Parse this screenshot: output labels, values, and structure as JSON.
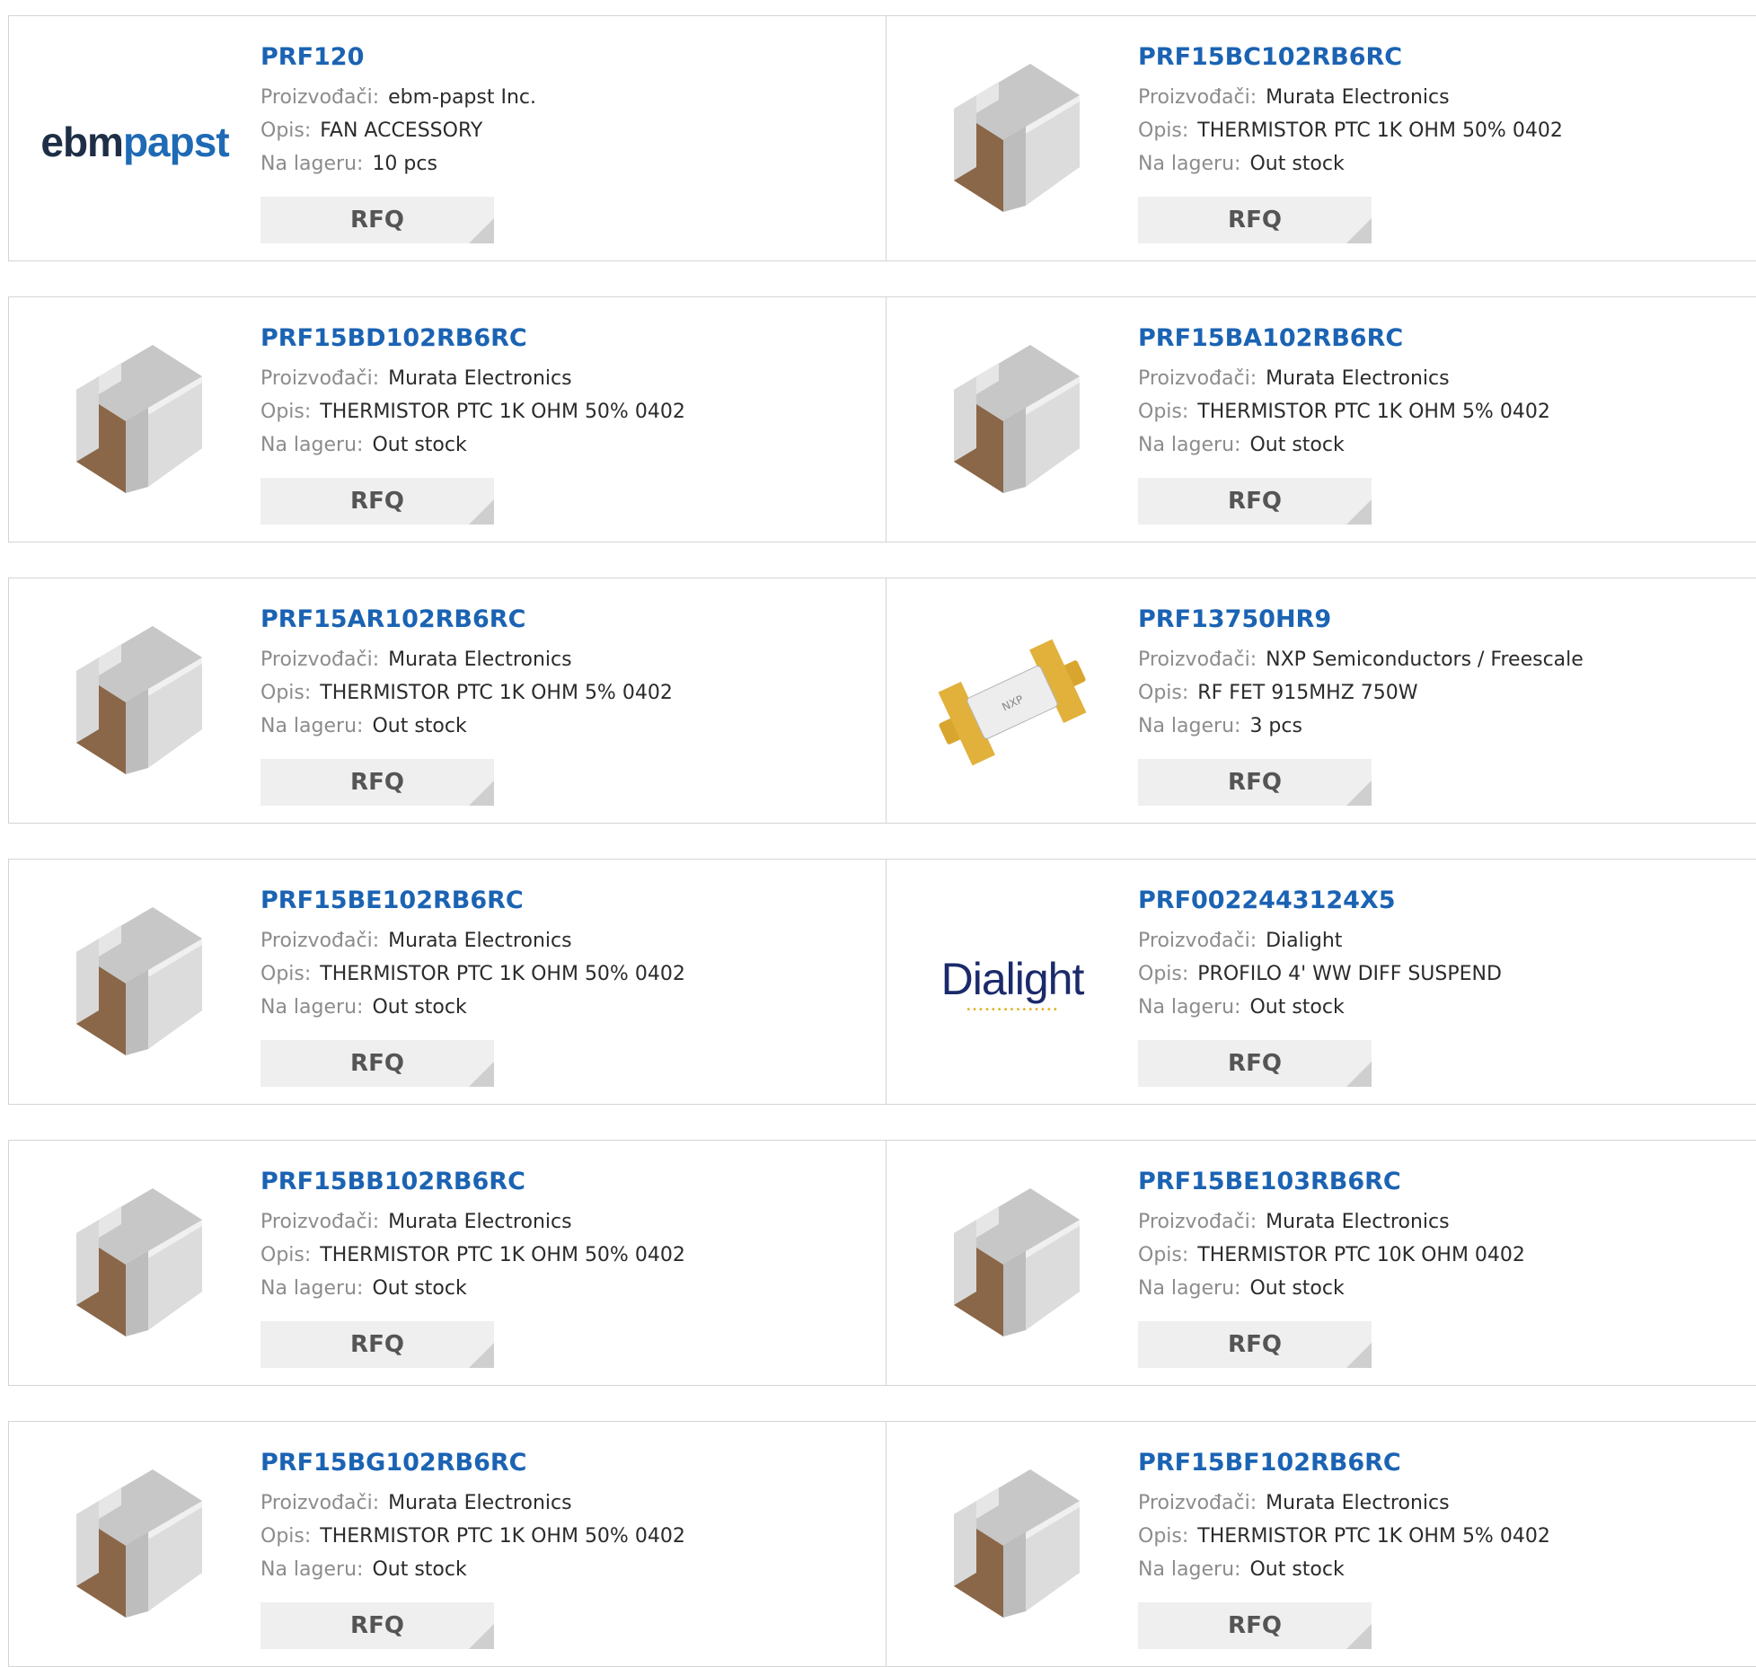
{
  "labels": {
    "manufacturer": "Proizvođači:",
    "description": "Opis:",
    "stock": "Na lageru:",
    "rfq": "RFQ"
  },
  "products": [
    {
      "part": "PRF120",
      "manufacturer": "ebm-papst Inc.",
      "description": "FAN ACCESSORY",
      "stock": "10 pcs",
      "image": "ebmpapst-logo",
      "logo_text": [
        "ebm",
        "papst"
      ]
    },
    {
      "part": "PRF15BC102RB6RC",
      "manufacturer": "Murata Electronics",
      "description": "THERMISTOR PTC 1K OHM 50% 0402",
      "stock": "Out stock",
      "image": "smd-chip-icon"
    },
    {
      "part": "PRF15BD102RB6RC",
      "manufacturer": "Murata Electronics",
      "description": "THERMISTOR PTC 1K OHM 50% 0402",
      "stock": "Out stock",
      "image": "smd-chip-icon"
    },
    {
      "part": "PRF15BA102RB6RC",
      "manufacturer": "Murata Electronics",
      "description": "THERMISTOR PTC 1K OHM 5% 0402",
      "stock": "Out stock",
      "image": "smd-chip-icon"
    },
    {
      "part": "PRF15AR102RB6RC",
      "manufacturer": "Murata Electronics",
      "description": "THERMISTOR PTC 1K OHM 5% 0402",
      "stock": "Out stock",
      "image": "smd-chip-icon"
    },
    {
      "part": "PRF13750HR9",
      "manufacturer": "NXP Semiconductors / Freescale",
      "description": "RF FET 915MHZ 750W",
      "stock": "3 pcs",
      "image": "rf-transistor-icon"
    },
    {
      "part": "PRF15BE102RB6RC",
      "manufacturer": "Murata Electronics",
      "description": "THERMISTOR PTC 1K OHM 50% 0402",
      "stock": "Out stock",
      "image": "smd-chip-icon"
    },
    {
      "part": "PRF0022443124X5",
      "manufacturer": "Dialight",
      "description": "PROFILO 4' WW DIFF SUSPEND",
      "stock": "Out stock",
      "image": "dialight-logo",
      "logo_text": [
        "Dialight"
      ]
    },
    {
      "part": "PRF15BB102RB6RC",
      "manufacturer": "Murata Electronics",
      "description": "THERMISTOR PTC 1K OHM 50% 0402",
      "stock": "Out stock",
      "image": "smd-chip-icon"
    },
    {
      "part": "PRF15BE103RB6RC",
      "manufacturer": "Murata Electronics",
      "description": "THERMISTOR PTC 10K OHM 0402",
      "stock": "Out stock",
      "image": "smd-chip-icon"
    },
    {
      "part": "PRF15BG102RB6RC",
      "manufacturer": "Murata Electronics",
      "description": "THERMISTOR PTC 1K OHM 50% 0402",
      "stock": "Out stock",
      "image": "smd-chip-icon"
    },
    {
      "part": "PRF15BF102RB6RC",
      "manufacturer": "Murata Electronics",
      "description": "THERMISTOR PTC 1K OHM 5% 0402",
      "stock": "Out stock",
      "image": "smd-chip-icon"
    }
  ],
  "colors": {
    "part_link": "#1b63b3",
    "label": "#8c8c8c",
    "value": "#2b2b2b",
    "rfq_bg": "#efefef",
    "border": "#d4d4d4"
  }
}
